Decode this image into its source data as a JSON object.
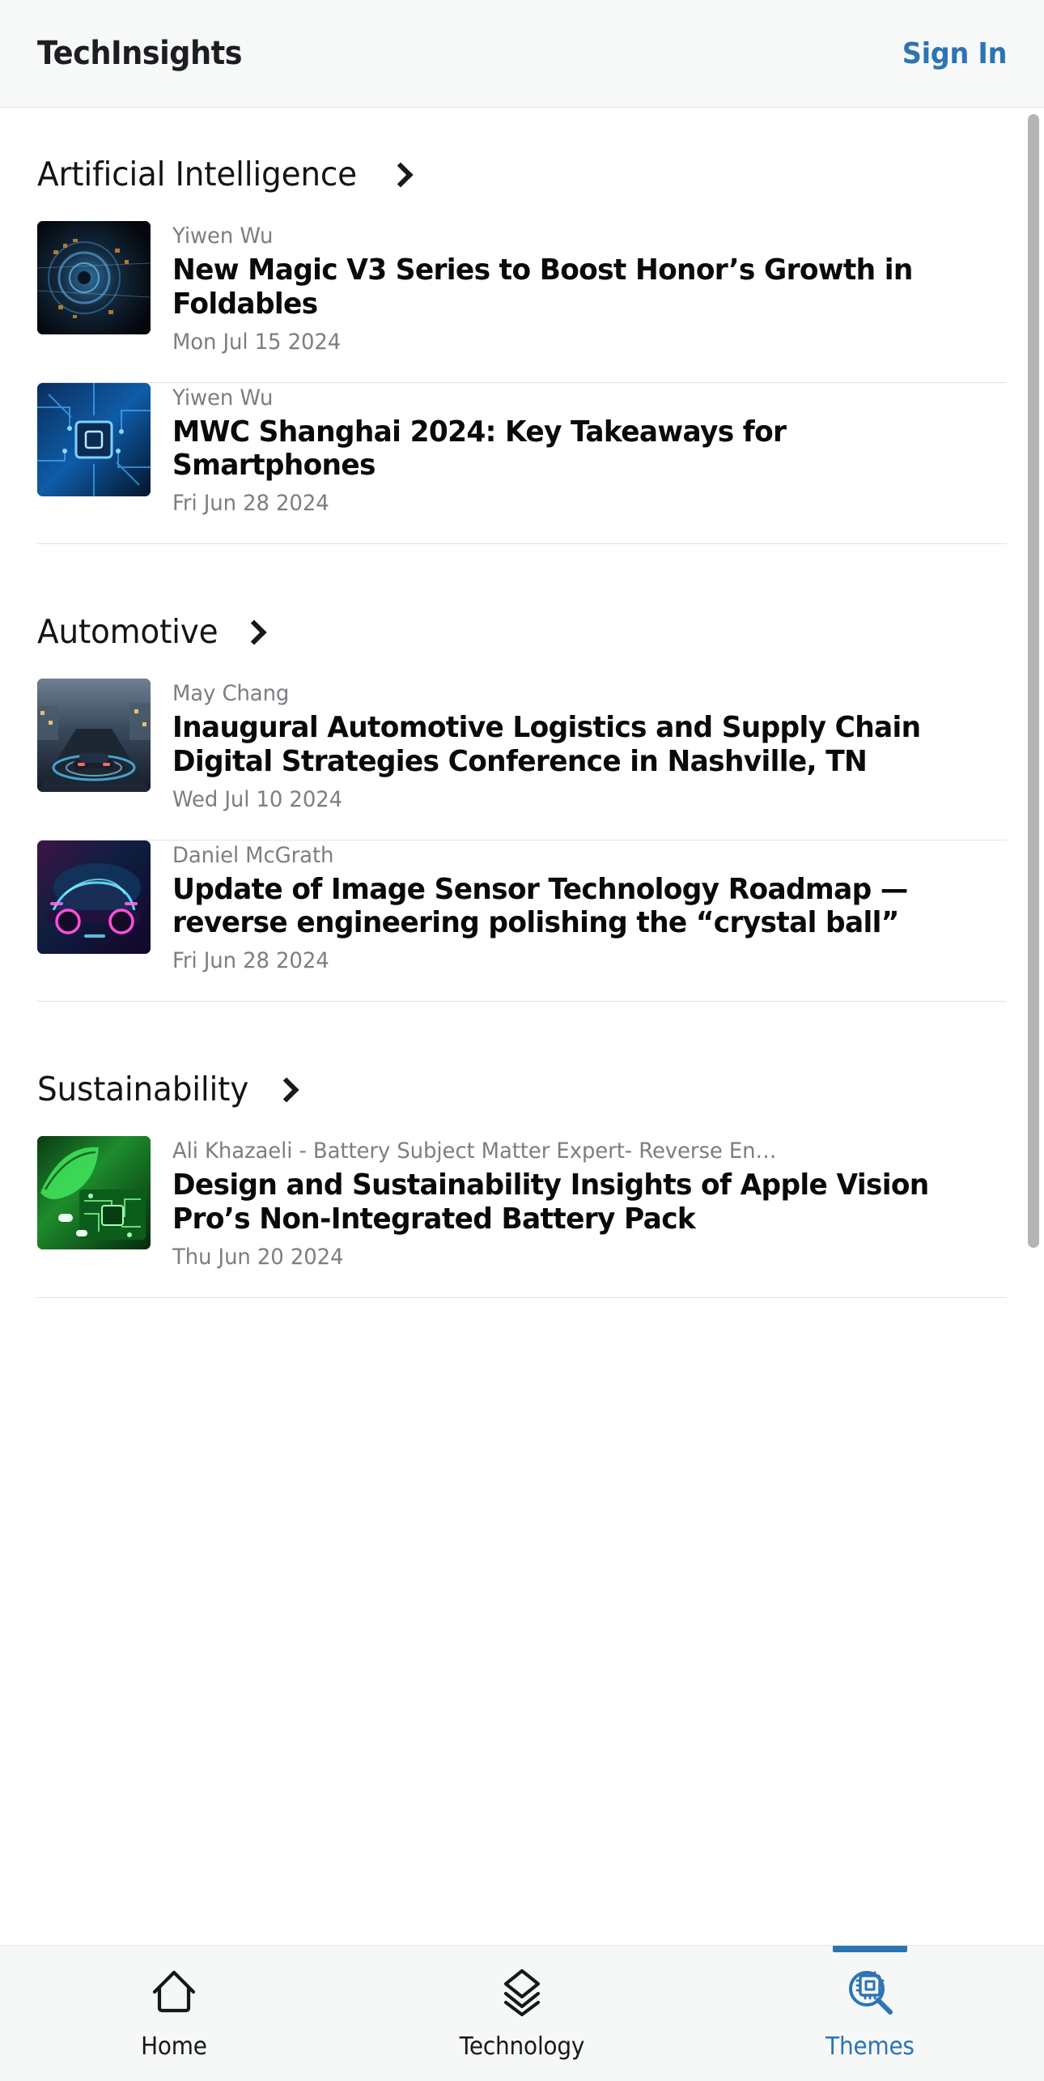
{
  "header": {
    "brand": "TechInsights",
    "signin_label": "Sign In"
  },
  "scrollbar": {
    "visible": true,
    "color": "#b2b4b6"
  },
  "accent_color": "#2c74b3",
  "sections": [
    {
      "title": "Artificial Intelligence",
      "chevron_icon": "chevron-right-icon",
      "articles": [
        {
          "author": "Yiwen Wu",
          "headline": "New Magic V3 Series to Boost Honor’s Growth in Foldables",
          "date": "Mon Jul 15 2024",
          "thumb": "ai-dark-sphere"
        },
        {
          "author": "Yiwen Wu",
          "headline": "MWC Shanghai 2024: Key Takeaways for Smartphones",
          "date": "Fri Jun 28 2024",
          "thumb": "blue-circuit-chip"
        }
      ]
    },
    {
      "title": "Automotive",
      "chevron_icon": "chevron-right-icon",
      "articles": [
        {
          "author": "May Chang",
          "headline": "Inaugural Automotive Logistics and Supply Chain Digital Strategies Conference in Nashville, TN",
          "date": "Wed Jul 10 2024",
          "thumb": "car-street-sensor"
        },
        {
          "author": "Daniel McGrath",
          "headline": "Update of Image Sensor Technology Roadmap — reverse engineering polishing the “crystal ball”",
          "date": "Fri Jun 28 2024",
          "thumb": "neon-car-magenta"
        }
      ]
    },
    {
      "title": "Sustainability",
      "chevron_icon": "chevron-right-icon",
      "articles": [
        {
          "author": "Ali Khazaeli - Battery Subject Matter Expert- Reverse En…",
          "headline": "Design and Sustainability Insights of Apple Vision Pro’s Non-Integrated Battery Pack",
          "date": "Thu Jun 20 2024",
          "thumb": "green-leaf-board"
        }
      ]
    }
  ],
  "tabbar": {
    "items": [
      {
        "label": "Home",
        "icon": "home-icon",
        "active": false
      },
      {
        "label": "Technology",
        "icon": "layers-icon",
        "active": false
      },
      {
        "label": "Themes",
        "icon": "chip-search-icon",
        "active": true
      }
    ]
  }
}
